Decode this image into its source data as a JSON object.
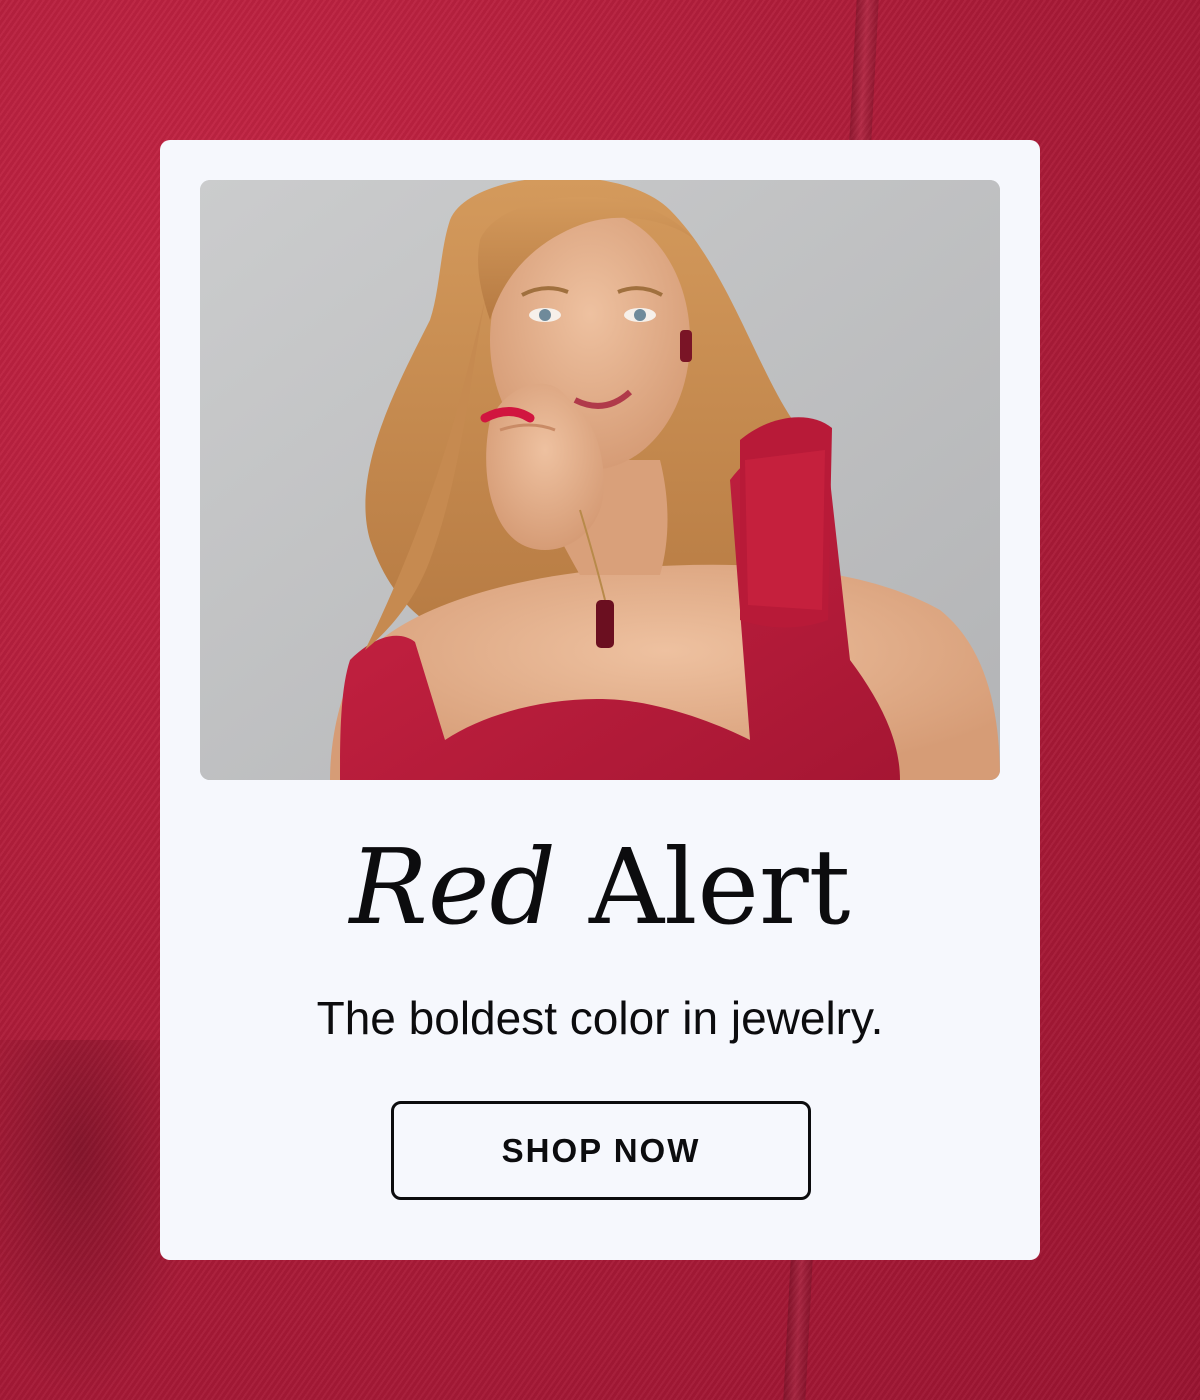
{
  "banner": {
    "headline_italic": "Red",
    "headline_regular": "Alert",
    "subheadline": "The boldest color in jewelry.",
    "cta_label": "SHOP NOW"
  },
  "colors": {
    "background": "#b01d3a",
    "card": "#f6f8fd",
    "text": "#0c0c0e",
    "dress": "#c0203d",
    "hair": "#c98a4e",
    "skin": "#e3b08c"
  }
}
